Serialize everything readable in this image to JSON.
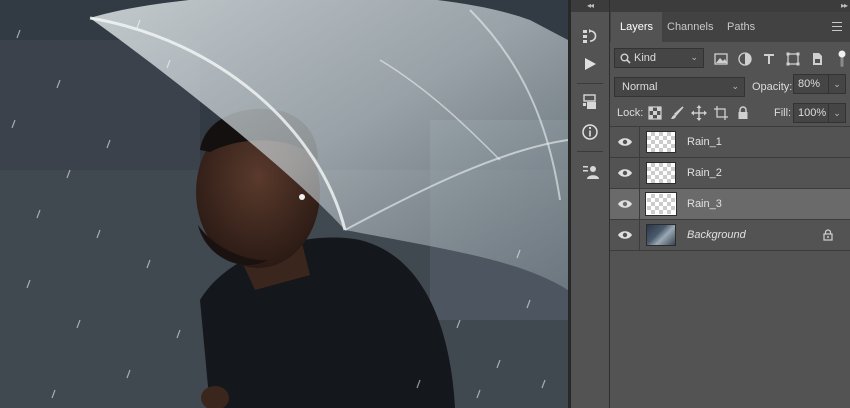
{
  "canvas": {
    "description_icon": "photo-canvas"
  },
  "toolstrip": {
    "collapse_icon": "double-chevron-left-icon",
    "tools": [
      {
        "icon": "history-icon"
      },
      {
        "icon": "play-icon"
      },
      {
        "icon": "3d-cube-icon"
      },
      {
        "icon": "info-icon"
      },
      {
        "icon": "properties-icon"
      }
    ]
  },
  "panel": {
    "collapse_icon": "double-chevron-left-icon",
    "tabs": [
      {
        "label": "Layers",
        "active": true
      },
      {
        "label": "Channels",
        "active": false
      },
      {
        "label": "Paths",
        "active": false
      }
    ],
    "filter": {
      "kind_label": "Kind",
      "icons": [
        "image-filter-icon",
        "adjustment-filter-icon",
        "type-filter-icon",
        "shape-filter-icon",
        "smart-object-filter-icon"
      ]
    },
    "blend_mode": "Normal",
    "opacity_label": "Opacity:",
    "opacity_value": "80%",
    "lock_label": "Lock:",
    "lock_icons": [
      "lock-transparent-icon",
      "lock-paint-icon",
      "lock-position-icon",
      "lock-artboard-icon",
      "lock-all-icon"
    ],
    "fill_label": "Fill:",
    "fill_value": "100%",
    "layers": [
      {
        "name": "Rain_1",
        "visible": true,
        "selected": false,
        "type": "transparent"
      },
      {
        "name": "Rain_2",
        "visible": true,
        "selected": false,
        "type": "transparent"
      },
      {
        "name": "Rain_3",
        "visible": true,
        "selected": true,
        "type": "transparent"
      },
      {
        "name": "Background",
        "visible": true,
        "selected": false,
        "type": "background",
        "locked": true
      }
    ]
  },
  "colors": {
    "panel_bg": "#535353",
    "tab_bar_bg": "#424242",
    "selected_layer": "#6a6a6a",
    "divider": "#282828"
  }
}
